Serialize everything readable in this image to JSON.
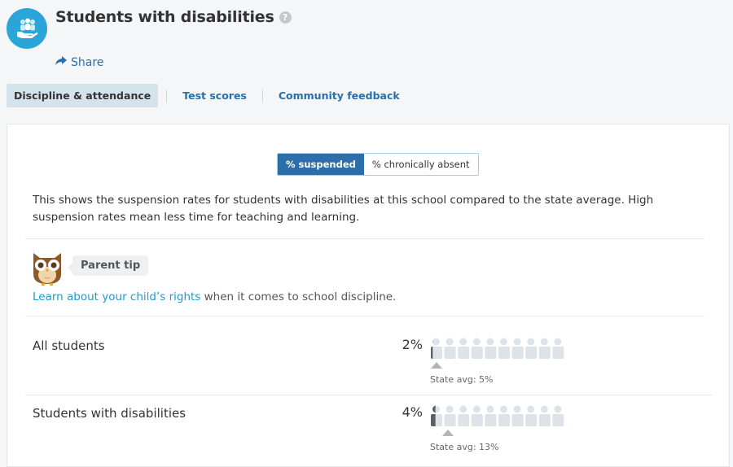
{
  "header": {
    "title": "Students with disabilities",
    "help_icon": "question-circle-icon",
    "icon": "students-hand-icon",
    "accent_color": "#2ba5d8"
  },
  "share": {
    "label": "Share",
    "icon": "share-arrow-icon"
  },
  "tabs": [
    {
      "label": "Discipline & attendance",
      "active": true
    },
    {
      "label": "Test scores",
      "active": false
    },
    {
      "label": "Community feedback",
      "active": false
    }
  ],
  "toggle": {
    "options": [
      {
        "label": "% suspended",
        "active": true
      },
      {
        "label": "% chronically absent",
        "active": false
      }
    ]
  },
  "description": "This shows the suspension rates for students with disabilities at this school compared to the state average. High suspension rates mean less time for teaching and learning.",
  "parent_tip": {
    "label": "Parent tip",
    "link_text": "Learn about your child’s rights",
    "rest_text": " when it comes to school discipline."
  },
  "rows": [
    {
      "label": "All students",
      "percent_text": "2%",
      "percent": 2,
      "state_avg_text": "State avg: 5%",
      "state_avg": 5
    },
    {
      "label": "Students with disabilities",
      "percent_text": "4%",
      "percent": 4,
      "state_avg_text": "State avg: 13%",
      "state_avg": 13
    }
  ]
}
